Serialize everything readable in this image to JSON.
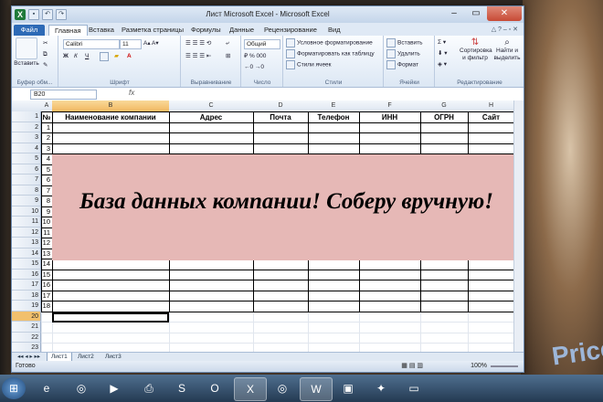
{
  "window": {
    "title": "Лист Microsoft Excel - Microsoft Excel"
  },
  "quick_access": [
    "save",
    "undo",
    "redo"
  ],
  "tabs": [
    "Файл",
    "Главная",
    "Вставка",
    "Разметка страницы",
    "Формулы",
    "Данные",
    "Рецензирование",
    "Вид"
  ],
  "ribbon": {
    "clipboard": {
      "paste": "Вставить",
      "label": "Буфер обм..."
    },
    "font": {
      "name": "Calibri",
      "size": "11",
      "bold": "Ж",
      "italic": "К",
      "underline": "Ч",
      "label": "Шрифт"
    },
    "alignment": {
      "label": "Выравнивание"
    },
    "number": {
      "format": "Общий",
      "label": "Число"
    },
    "styles": {
      "cond": "Условное форматирование",
      "table": "Форматировать как таблицу",
      "cell": "Стили ячеек",
      "label": "Стили"
    },
    "cells": {
      "insert": "Вставить",
      "delete": "Удалить",
      "format": "Формат",
      "label": "Ячейки"
    },
    "editing": {
      "sort": "Сортировка и фильтр",
      "find": "Найти и выделить",
      "label": "Редактирование"
    }
  },
  "formula_bar": {
    "name_box": "B20",
    "fx": "fx",
    "value": ""
  },
  "sheet": {
    "columns": [
      "A",
      "B",
      "C",
      "D",
      "E",
      "F",
      "G",
      "H"
    ],
    "rows": [
      "1",
      "2",
      "3",
      "4",
      "5",
      "6",
      "7",
      "8",
      "9",
      "10",
      "11",
      "12",
      "13",
      "14",
      "15",
      "16",
      "17",
      "18",
      "19",
      "20",
      "21",
      "22",
      "23"
    ],
    "headers": {
      "A": "№",
      "B": "Наименование компании",
      "C": "Адрес",
      "D": "Почта",
      "E": "Телефон",
      "F": "ИНН",
      "G": "ОГРН",
      "H": "Сайт"
    },
    "numbers": [
      "1",
      "2",
      "3",
      "4",
      "5",
      "6",
      "7",
      "8",
      "9",
      "10",
      "11",
      "12",
      "13",
      "14",
      "15",
      "16",
      "17",
      "18"
    ],
    "banner": "База данных компании! Соберу вручную!",
    "selected_cell": "B20"
  },
  "sheet_tabs": [
    "Лист1",
    "Лист2",
    "Лист3"
  ],
  "status": {
    "ready": "Готово",
    "zoom": "100%"
  },
  "background": {
    "watermark": "Price"
  },
  "taskbar": [
    "ie",
    "chrome",
    "media",
    "folder",
    "skype",
    "outlook",
    "excel",
    "chrome2",
    "word",
    "app",
    "app2",
    "explorer"
  ]
}
